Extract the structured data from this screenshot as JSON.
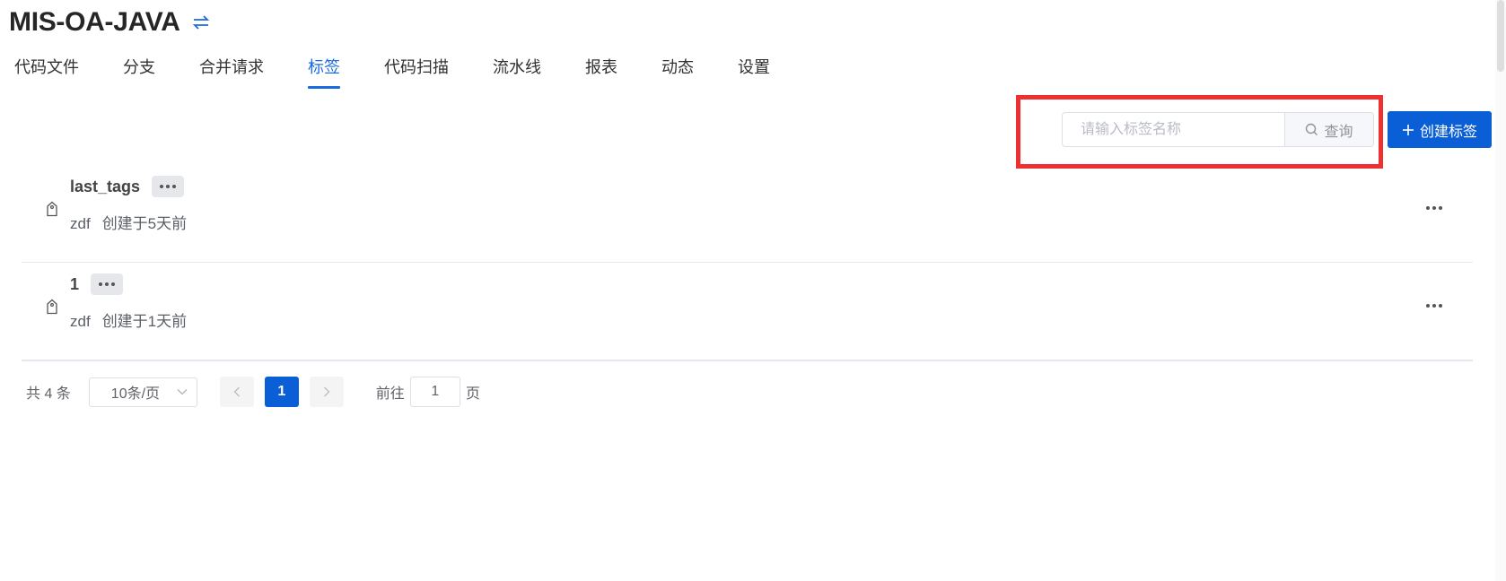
{
  "repo": {
    "title": "MIS-OA-JAVA",
    "switch_icon": "switch-arrows-icon"
  },
  "tabs": [
    {
      "label": "代码文件",
      "active": false
    },
    {
      "label": "分支",
      "active": false
    },
    {
      "label": "合并请求",
      "active": false
    },
    {
      "label": "标签",
      "active": true
    },
    {
      "label": "代码扫描",
      "active": false
    },
    {
      "label": "流水线",
      "active": false
    },
    {
      "label": "报表",
      "active": false
    },
    {
      "label": "动态",
      "active": false
    },
    {
      "label": "设置",
      "active": false
    }
  ],
  "search": {
    "placeholder": "请输入标签名称",
    "value": "",
    "button_label": "查询"
  },
  "create_button": {
    "label": "创建标签"
  },
  "tags": [
    {
      "name": "last_tags",
      "author": "zdf",
      "created": "创建于5天前"
    },
    {
      "name": "1",
      "author": "zdf",
      "created": "创建于1天前"
    }
  ],
  "pagination": {
    "total": "共 4 条",
    "page_size": "10条/页",
    "current_page": "1",
    "goto_label": "前往",
    "goto_value": "1",
    "page_suffix": "页"
  },
  "colors": {
    "accent": "#0a5fd7",
    "highlight": "#ef3030"
  }
}
